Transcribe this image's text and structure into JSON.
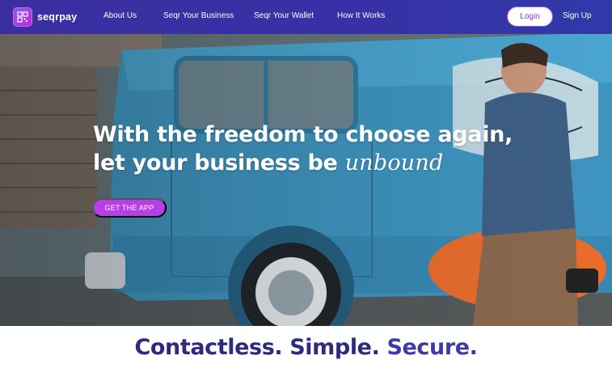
{
  "brand": {
    "name": "seqrpay",
    "icon": "qr-grid-icon"
  },
  "nav": {
    "links": [
      "About Us",
      "Seqr Your Business",
      "Seqr Your Wallet",
      "How It Works"
    ],
    "login": "Login",
    "signup": "Sign Up"
  },
  "hero": {
    "line1": "With the freedom to choose again,",
    "line2_prefix": "let your business be",
    "line2_script": "unbound",
    "cta": "GET THE APP"
  },
  "tagline": {
    "part1": "Contactless.",
    "part2": "Simple.",
    "part3": "Secure."
  },
  "colors": {
    "nav": "#3730a6",
    "accent": "#b83ee8",
    "tagline_dark": "#2e2a80",
    "tagline_light": "#3f3aa8"
  }
}
